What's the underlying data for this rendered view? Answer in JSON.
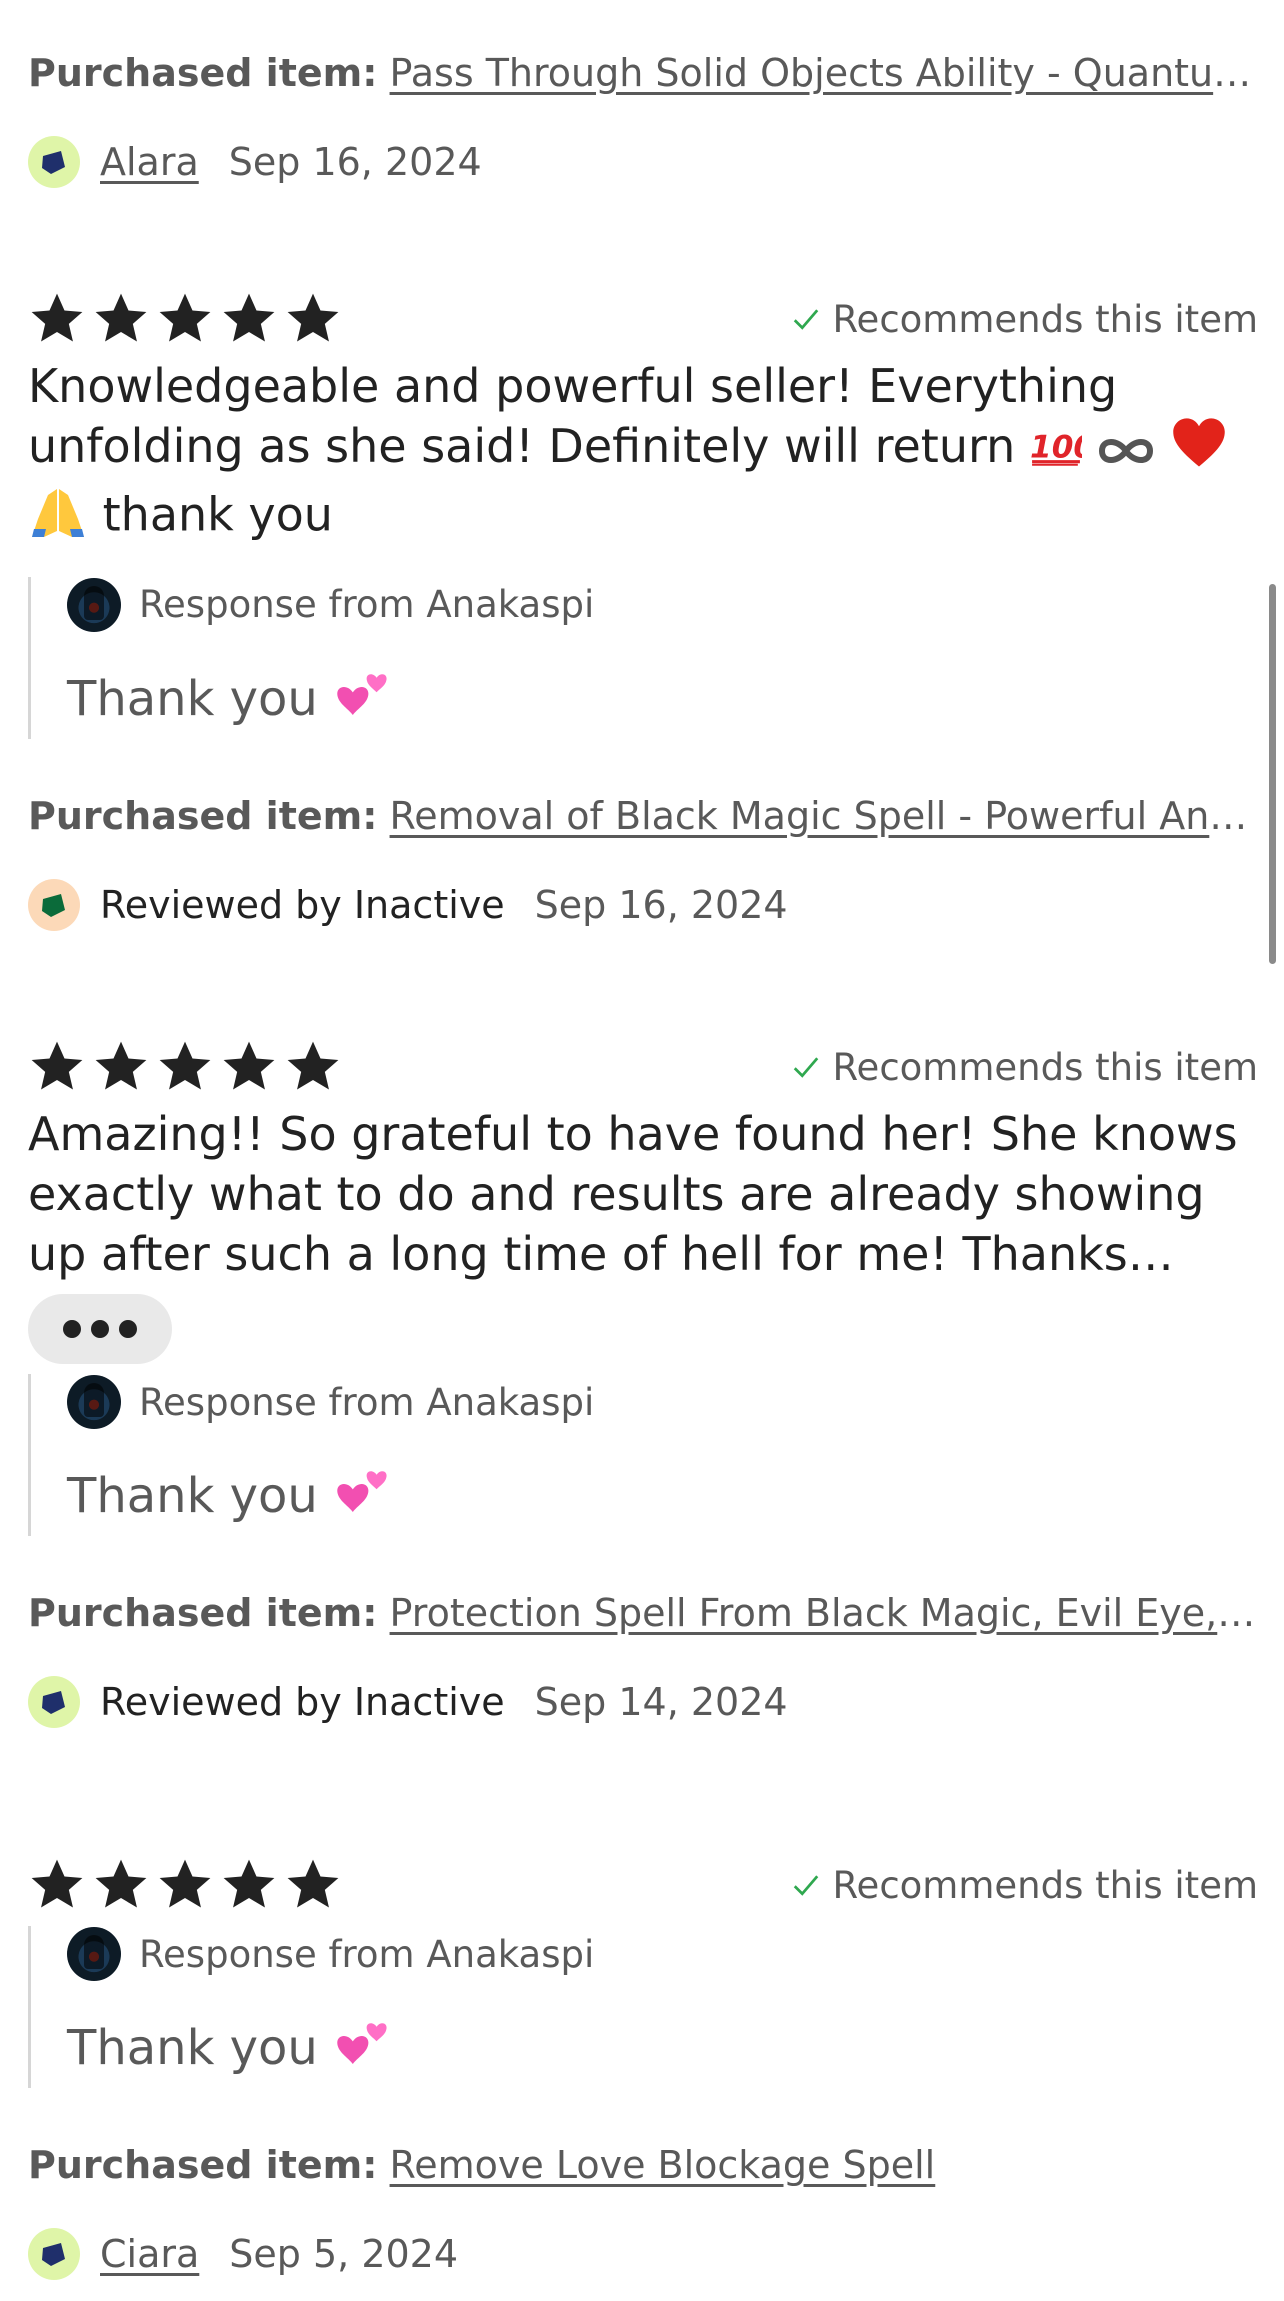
{
  "reviews": [
    {
      "purchased_label": "Purchased item:",
      "purchased_item": "Pass Through Solid Objects Ability - Quantum Leap Spell",
      "reviewer": "Alara",
      "date": "Sep 16, 2024"
    },
    {
      "recommends": "Recommends this item",
      "text": "Knowledgeable and powerful seller! Everything unfolding as she said! Definitely will return",
      "text_end": "thank you",
      "response_from": "Response from Anakaspi",
      "response_text": "Thank you",
      "purchased_label": "Purchased item:",
      "purchased_item": "Removal of Black Magic Spell - Powerful Ancient Ritual",
      "reviewer": "Reviewed by Inactive",
      "date": "Sep 16, 2024"
    },
    {
      "recommends": "Recommends this item",
      "text": "Amazing!! So grateful to have found her! She knows exactly what to do and results are already showing up after such a long time of hell for me! Thanks lovely",
      "response_from": "Response from Anakaspi",
      "response_text": "Thank you",
      "purchased_label": "Purchased item:",
      "purchased_item": "Protection Spell From Black Magic, Evil Eye, Negative Energy",
      "reviewer": "Reviewed by Inactive",
      "date": "Sep 14, 2024"
    },
    {
      "recommends": "Recommends this item",
      "response_from": "Response from Anakaspi",
      "response_text": "Thank you",
      "purchased_label": "Purchased item:",
      "purchased_item": "Remove Love Blockage Spell",
      "reviewer": "Ciara",
      "date": "Sep 5, 2024"
    }
  ],
  "rating": 5,
  "colors": {
    "star": "#222222",
    "check": "#2fa84f",
    "badge_green": "#dff5a8",
    "badge_peach": "#fcd9b8",
    "shape_navy": "#1f2f6b",
    "shape_green": "#0b6b3a"
  }
}
